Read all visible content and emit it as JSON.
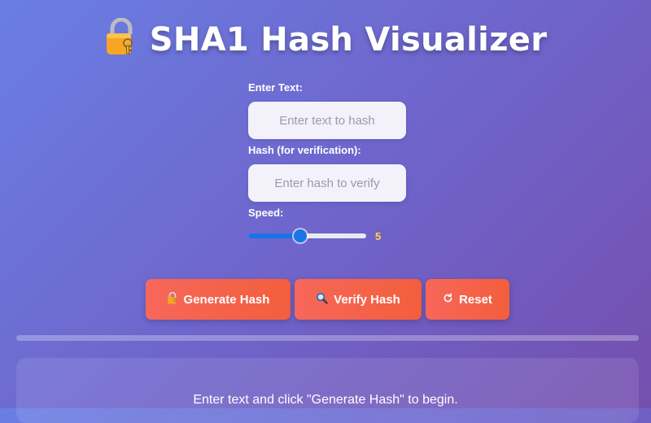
{
  "header": {
    "icon": "lock-key-icon",
    "title": "SHA1 Hash Visualizer"
  },
  "form": {
    "text_label": "Enter Text:",
    "text_placeholder": "Enter text to hash",
    "text_value": "",
    "hash_label": "Hash (for verification):",
    "hash_placeholder": "Enter hash to verify",
    "hash_value": "",
    "speed_label": "Speed:",
    "speed_value": "5",
    "speed_min": 1,
    "speed_max": 10
  },
  "buttons": {
    "generate": {
      "icon": "lock-key-icon",
      "label": "Generate Hash"
    },
    "verify": {
      "icon": "magnifier-icon",
      "label": "Verify Hash"
    },
    "reset": {
      "icon": "refresh-icon",
      "label": "Reset"
    }
  },
  "progress": {
    "fraction": 0
  },
  "output": {
    "message": "Enter text and click \"Generate Hash\" to begin."
  },
  "colors": {
    "button": "#f46450",
    "slider": "#1a73e8",
    "speed_value": "#ffd84a"
  }
}
